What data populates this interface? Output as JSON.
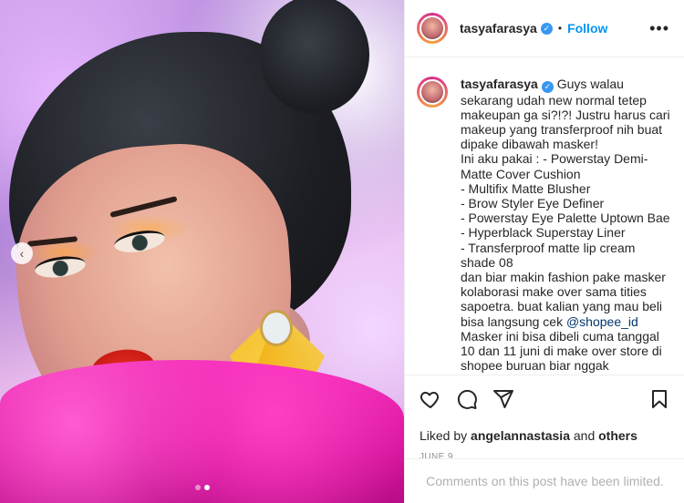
{
  "post": {
    "username": "tasyafarasya",
    "verified_mark": "✓",
    "separator": "•",
    "follow_label": "Follow",
    "more_label": "•••"
  },
  "caption": {
    "username": "tasyafarasya",
    "text_1": "Guys walau sekarang udah new normal tetep makeupan ga si?!?! Justru harus cari makeup yang transferproof nih buat dipake dibawah masker!",
    "text_2": "Ini aku pakai : - Powerstay Demi-Matte Cover Cushion",
    "text_3": "- Multifix Matte Blusher",
    "text_4": "- Brow Styler Eye Definer",
    "text_5": "- Powerstay Eye Palette Uptown Bae - Hyperblack Superstay Liner",
    "text_6": "- Transferproof matte lip cream shade 08",
    "text_7": "dan biar makin fashion pake masker kolaborasi make over sama tities sapoetra. buat kalian yang mau beli bisa langsung cek ",
    "mention": "@shopee_id",
    "text_8": "Masker ini bisa dibeli cuma tanggal 10 dan 11 juni di make over store di shopee buruan biar nggak kehabisan!"
  },
  "actions": {
    "icons": [
      "heart-icon",
      "comment-icon",
      "share-icon",
      "bookmark-icon"
    ],
    "liked_by_prefix": "Liked by",
    "liked_by_user": "angelannastasia",
    "liked_by_and": "and",
    "liked_by_others": "others",
    "date": "JUNE 9",
    "comments_limited": "Comments on this post have been limited."
  },
  "carousel": {
    "prev_icon": "chevron-left-icon",
    "prev_glyph": "‹",
    "slide_count": 2,
    "active_slide": 2
  },
  "colors": {
    "accent": "#0095f6",
    "verified": "#3897f0",
    "text": "#262626",
    "muted": "#8e8e8e"
  }
}
